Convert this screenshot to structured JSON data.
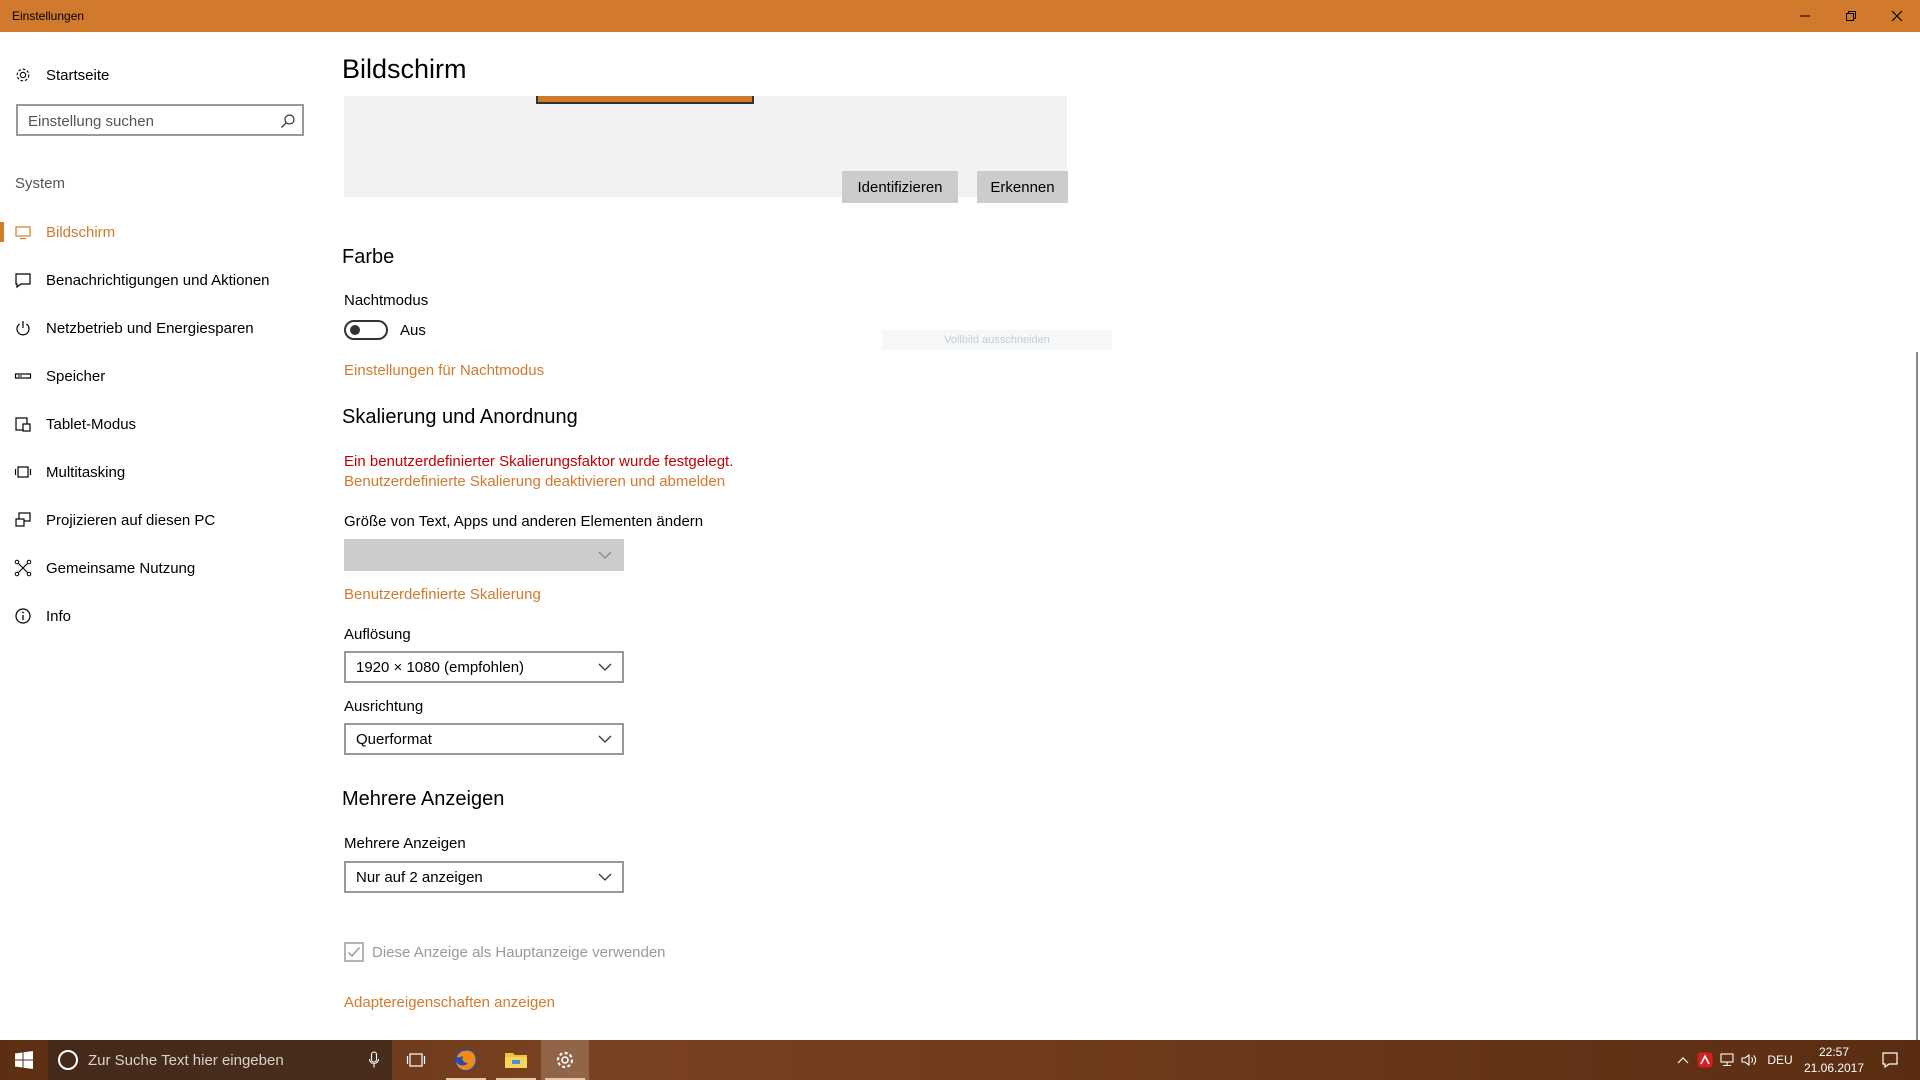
{
  "window": {
    "title": "Einstellungen"
  },
  "sidebar": {
    "home_label": "Startseite",
    "search_placeholder": "Einstellung suchen",
    "section_label": "System",
    "items": [
      {
        "label": "Bildschirm",
        "icon": "monitor-icon",
        "active": true
      },
      {
        "label": "Benachrichtigungen und Aktionen",
        "icon": "notification-icon"
      },
      {
        "label": "Netzbetrieb und Energiesparen",
        "icon": "power-icon"
      },
      {
        "label": "Speicher",
        "icon": "storage-icon"
      },
      {
        "label": "Tablet-Modus",
        "icon": "tablet-icon"
      },
      {
        "label": "Multitasking",
        "icon": "multitasking-icon"
      },
      {
        "label": "Projizieren auf diesen PC",
        "icon": "project-icon"
      },
      {
        "label": "Gemeinsame Nutzung",
        "icon": "share-icon"
      },
      {
        "label": "Info",
        "icon": "info-icon"
      }
    ]
  },
  "main": {
    "title": "Bildschirm",
    "identify_label": "Identifizieren",
    "detect_label": "Erkennen",
    "color_section": {
      "heading": "Farbe",
      "night_mode_label": "Nachtmodus",
      "night_mode_state": "Aus",
      "night_mode_link": "Einstellungen für Nachtmodus"
    },
    "ghost_text": "Vollbild ausschneiden",
    "scaling_section": {
      "heading": "Skalierung und Anordnung",
      "warning": "Ein benutzerdefinierter Skalierungsfaktor wurde festgelegt.",
      "disable_link": "Benutzerdefinierte Skalierung deaktivieren und abmelden",
      "size_label": "Größe von Text, Apps und anderen Elementen ändern",
      "size_value": "",
      "custom_link": "Benutzerdefinierte Skalierung",
      "resolution_label": "Auflösung",
      "resolution_value": "1920 × 1080 (empfohlen)",
      "orientation_label": "Ausrichtung",
      "orientation_value": "Querformat"
    },
    "multi_section": {
      "heading": "Mehrere Anzeigen",
      "label": "Mehrere Anzeigen",
      "value": "Nur auf 2 anzeigen",
      "checkbox_label": "Diese Anzeige als Hauptanzeige verwenden",
      "checkbox_checked": true,
      "adapter_link": "Adaptereigenschaften anzeigen"
    }
  },
  "taskbar": {
    "search_placeholder": "Zur Suche Text hier eingeben",
    "language": "DEU",
    "time": "22:57",
    "date": "21.06.2017"
  },
  "colors": {
    "accent": "#d17a2d",
    "error": "#c50000"
  }
}
